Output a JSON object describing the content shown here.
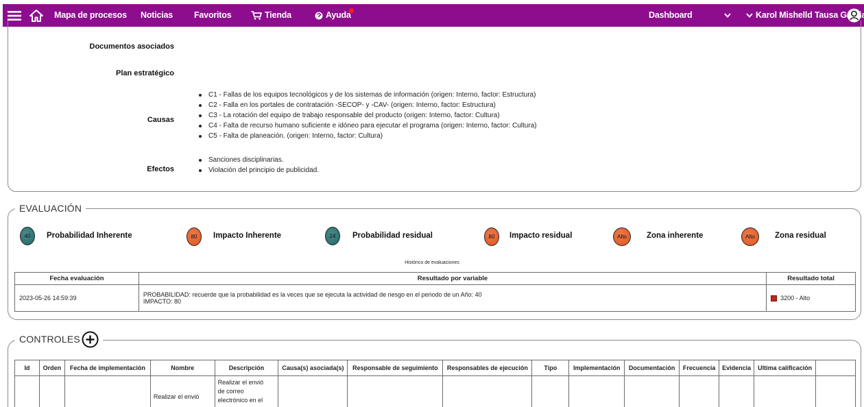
{
  "navbar": {
    "menu_icon": "menu-icon",
    "home_icon": "home-icon",
    "items": [
      "Mapa de procesos",
      "Noticias",
      "Favoritos",
      "Tienda",
      "Ayuda"
    ],
    "dashboard": "Dashboard",
    "user_name": "Karol Mishelld Tausa Garcia",
    "accent_color": "#8e0d8e"
  },
  "detail": {
    "documentos_label": "Documentos asociados",
    "plan_label": "Plan estratégico",
    "causas_label": "Causas",
    "causas": [
      "C1 - Fallas de los equipos tecnológicos y de los sistemas de información (origen: Interno, factor: Estructura)",
      "C2 - Falla en los portales de contratación -SECOP- y -CAV- (origen: Interno, factor: Estructura)",
      "C3 - La rotación del equipo de trabajo responsable del producto (origen: Interno, factor: Cultura)",
      "C4 - Falta de recurso humano suficiente e idóneo para ejecutar el programa (origen: Interno, factor: Cultura)",
      "C5 - Falta de planeación. (origen: Interno, factor: Cultura)"
    ],
    "efectos_label": "Efectos",
    "efectos": [
      "Sanciones disciplinarias.",
      "Violación del principio de publicidad."
    ]
  },
  "evaluacion": {
    "legend": "EVALUACIÓN",
    "indicators": [
      {
        "value": "40",
        "label": "Probabilidad Inherente",
        "color": "#1f6b6b"
      },
      {
        "value": "80",
        "label": "Impacto Inherente",
        "color": "#e4571d"
      },
      {
        "value": "24",
        "label": "Probabilidad residual",
        "color": "#1f6b6b"
      },
      {
        "value": "80",
        "label": "Impacto residual",
        "color": "#e4571d"
      },
      {
        "value": "Alto",
        "label": "Zona inherente",
        "color": "#e4571d"
      },
      {
        "value": "Alto",
        "label": "Zona residual",
        "color": "#e4571d"
      }
    ],
    "historico_caption": "Histórico de evaluaciones",
    "table": {
      "headers": [
        "Fecha evaluación",
        "Resultado por variable",
        "Resultado total"
      ],
      "rows": [
        {
          "fecha": "2023-05-26 14:59:39",
          "resultado_line1": "PROBABILIDAD: recuerde que la probabilidad es la veces que se ejecuta la actividad de riesgo en el periodo de un Año: 40",
          "resultado_line2": "IMPACTO: 80",
          "total": "3200 - Alto",
          "total_color": "#c0261c"
        }
      ]
    }
  },
  "controles": {
    "legend": "CONTROLES",
    "add_icon": "plus-circle-icon",
    "headers": [
      "Id",
      "Orden",
      "Fecha de implementación",
      "Nombre",
      "Descripción",
      "Causa(s) asociada(s)",
      "Responsable de seguimiento",
      "Responsables de ejecución",
      "Tipo",
      "Implementación",
      "Documentación",
      "Frecuencia",
      "Evidencia",
      "Ultima calificación",
      ""
    ],
    "rows": [
      {
        "nombre": "Realizar el envió",
        "descripcion": "Realizar el envió\nde correo\nelectrónico en el"
      }
    ]
  }
}
